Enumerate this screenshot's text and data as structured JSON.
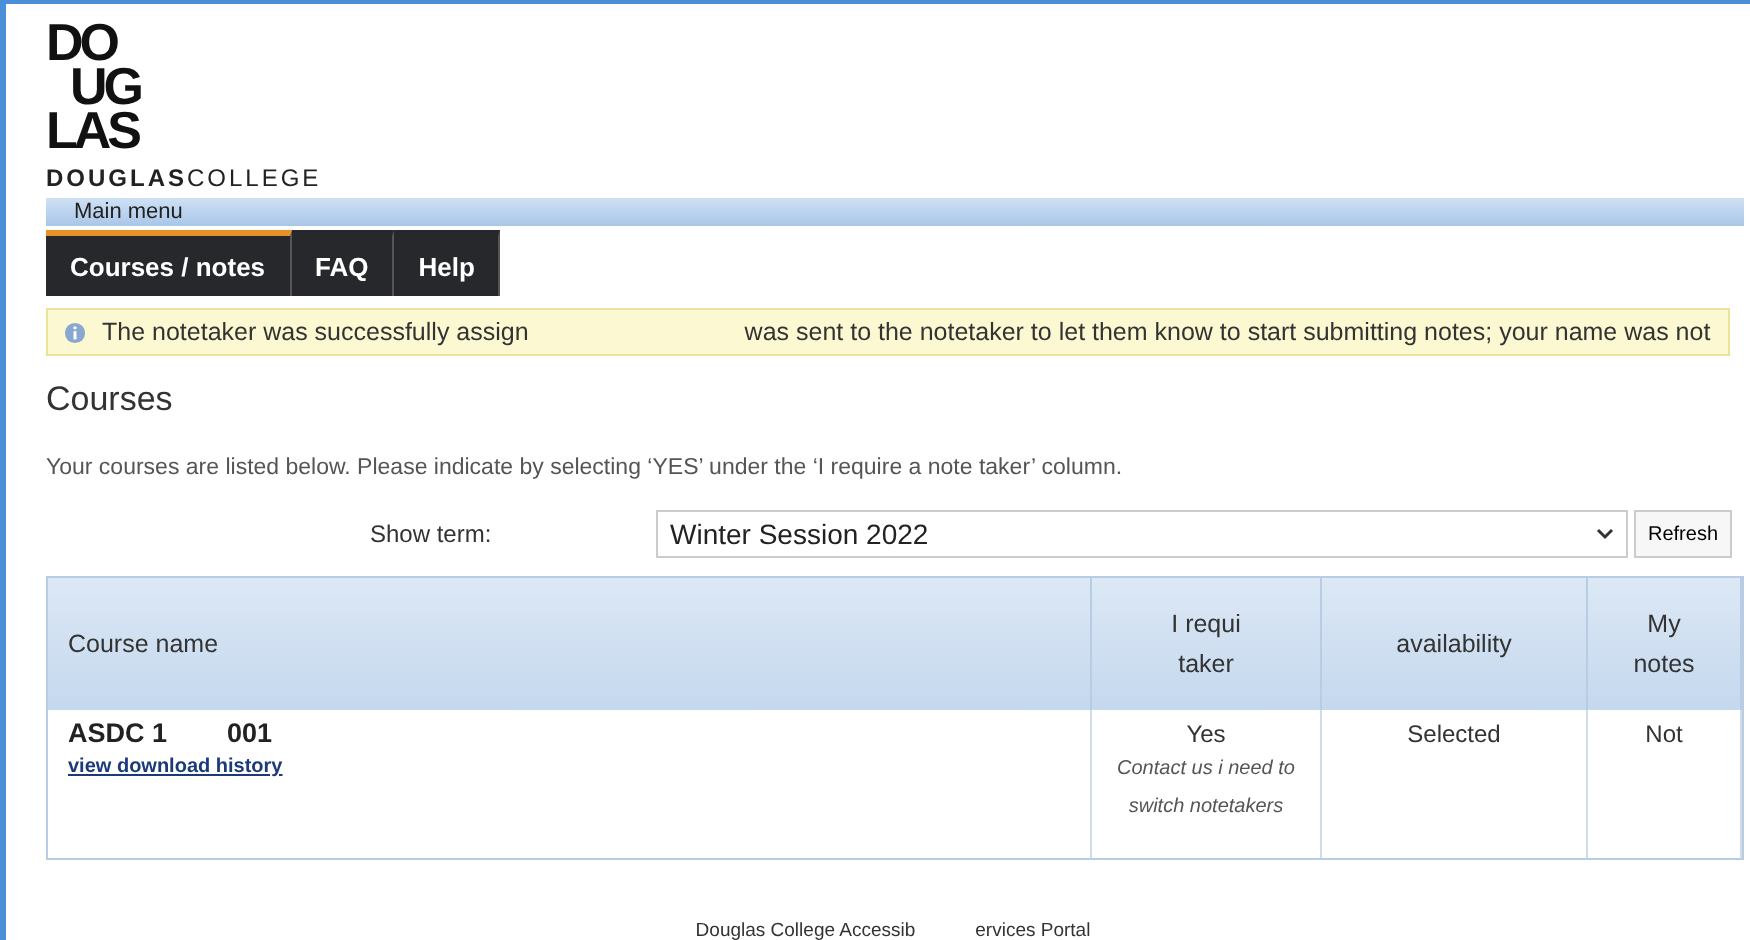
{
  "logo": {
    "stack": [
      "DO",
      "UG",
      "LAS"
    ],
    "wordmark_bold": "DOUGLAS",
    "wordmark_light": "COLLEGE"
  },
  "main_menu": {
    "label": "Main menu"
  },
  "tabs": [
    {
      "label": "Courses / notes",
      "selected": true
    },
    {
      "label": "FAQ",
      "selected": false
    },
    {
      "label": "Help",
      "selected": false
    }
  ],
  "alert": {
    "text_start": "The notetaker was successfully assign",
    "text_end": "was sent to the notetaker to let them know to start submitting notes; your name was not"
  },
  "heading": "Courses",
  "intro": "Your courses are listed below. Please indicate by selecting ‘YES’ under the ‘I require a note taker’ column.",
  "term": {
    "label": "Show term:",
    "value": "Winter Session 2022",
    "button": "Refresh"
  },
  "table": {
    "columns": [
      {
        "lines": [
          "Course name"
        ]
      },
      {
        "lines": [
          "I requi",
          "taker"
        ]
      },
      {
        "lines": [
          "availability"
        ]
      },
      {
        "lines": [
          "My",
          "notes"
        ]
      }
    ],
    "rows": [
      {
        "course_start": "ASDC 1",
        "course_end": "001",
        "link": "view download history",
        "requires": "Yes",
        "note": "Contact us i",
        "note_rest": "need to switch notetakers",
        "availability": "Selected",
        "my_notes": "Not"
      }
    ]
  },
  "footer": {
    "start": "Douglas College Accessib",
    "end": "ervices Portal"
  }
}
